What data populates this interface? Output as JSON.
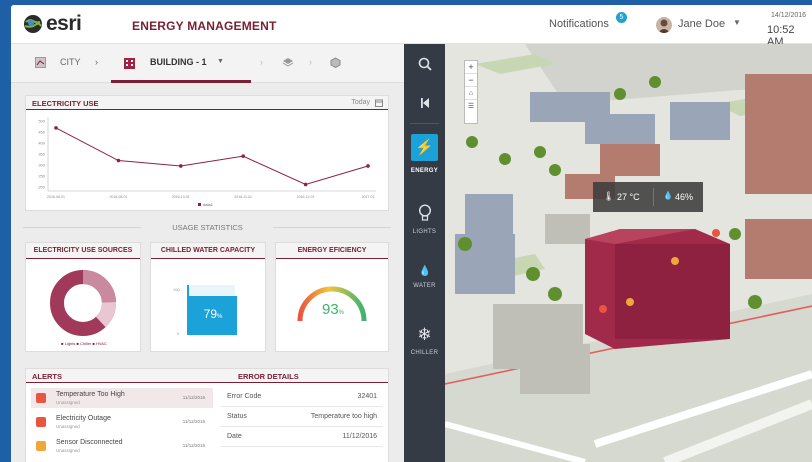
{
  "header": {
    "logo_text": "esri",
    "app_title": "ENERGY MANAGEMENT",
    "notifications_label": "Notifications",
    "notifications_count": "5",
    "user_name": "Jane Doe",
    "date": "14/12/2016",
    "time": "10:52 AM"
  },
  "breadcrumb": {
    "city": "CITY",
    "building": "BUILDING - 1"
  },
  "electricity_use": {
    "title": "ELECTRICITY USE",
    "range_label": "Today",
    "legend": "data1",
    "y_ticks": [
      "500",
      "450",
      "400",
      "350",
      "300",
      "250",
      "200"
    ],
    "x_ticks": [
      "2016-06-01",
      "2016-08-01",
      "2016-10-01",
      "2016-11-01",
      "2016-12-01",
      "2017-01"
    ]
  },
  "chart_data": {
    "type": "line",
    "title": "ELECTRICITY USE",
    "series": [
      {
        "name": "data1",
        "values": [
          470,
          320,
          295,
          340,
          210,
          295
        ]
      }
    ],
    "categories": [
      "2016-06-01",
      "2016-08-01",
      "2016-10-01",
      "2016-11-01",
      "2016-12-01",
      "2017-01"
    ],
    "ylim": [
      180,
      520
    ],
    "grid": false,
    "legend": "bottom"
  },
  "usage_statistics_label": "USAGE STATISTICS",
  "sources": {
    "title": "ELECTRICITY USE SOURCES",
    "legend": "■ Lights  ■ Chiller  ■ HVAC"
  },
  "chilled_water": {
    "title": "CHILLED WATER CAPACITY",
    "value": "79",
    "unit": "%",
    "fill_fraction": 0.79,
    "scale_top": "100",
    "scale_bottom": "0"
  },
  "efficiency": {
    "title": "ENERGY EFICIENCY",
    "value": "93",
    "unit": "%",
    "fraction": 0.93
  },
  "alerts": {
    "title": "ALERTS",
    "items": [
      {
        "title": "Temperature Too High",
        "sub": "Unassigned",
        "date": "11/12/2016",
        "color": "#e9553e"
      },
      {
        "title": "Electricity Outage",
        "sub": "Unassigned",
        "date": "11/12/2016",
        "color": "#e9553e"
      },
      {
        "title": "Sensor Disconnected",
        "sub": "Unassigned",
        "date": "11/12/2016",
        "color": "#f0a73a"
      }
    ]
  },
  "error_details": {
    "title": "ERROR DETAILS",
    "rows": [
      {
        "label": "Error Code",
        "value": "32401"
      },
      {
        "label": "Status",
        "value": "Temperature too high"
      },
      {
        "label": "Date",
        "value": "11/12/2016"
      }
    ]
  },
  "rail": {
    "energy": "ENERGY",
    "lights": "LIGHTS",
    "water": "WATER",
    "chiller": "CHILLER"
  },
  "map": {
    "temperature": "27 °C",
    "humidity": "46%"
  },
  "colors": {
    "accent": "#7a2035",
    "energy_active": "#1aa2d9",
    "rail": "#343b45"
  }
}
